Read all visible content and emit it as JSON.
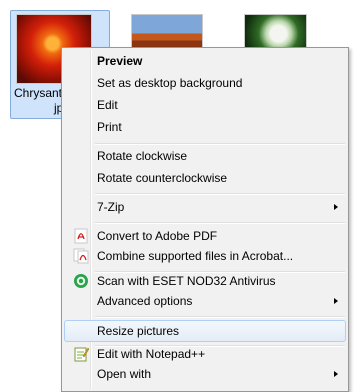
{
  "file": {
    "label_line1": "Chrysant",
    "label_line2": "jp"
  },
  "menu": {
    "items": [
      {
        "label": "Preview"
      },
      {
        "label": "Set as desktop background"
      },
      {
        "label": "Edit"
      },
      {
        "label": "Print"
      },
      {
        "label": "Rotate clockwise"
      },
      {
        "label": "Rotate counterclockwise"
      },
      {
        "label": "7-Zip"
      },
      {
        "label": "Convert to Adobe PDF"
      },
      {
        "label": "Combine supported files in Acrobat..."
      },
      {
        "label": "Scan with ESET NOD32 Antivirus"
      },
      {
        "label": "Advanced options"
      },
      {
        "label": "Resize pictures"
      },
      {
        "label": "Edit with Notepad++"
      },
      {
        "label": "Open with"
      }
    ]
  },
  "icons": {
    "pdf": "pdf-icon",
    "pdf_combine": "pdf-combine-icon",
    "eset": "eset-nod32-icon",
    "notepad": "notepad-plus-plus-icon"
  },
  "colors": {
    "selection_bg": "#cfe3fb",
    "hover_border": "#aecff7",
    "menu_bg": "#f1f1f1"
  }
}
